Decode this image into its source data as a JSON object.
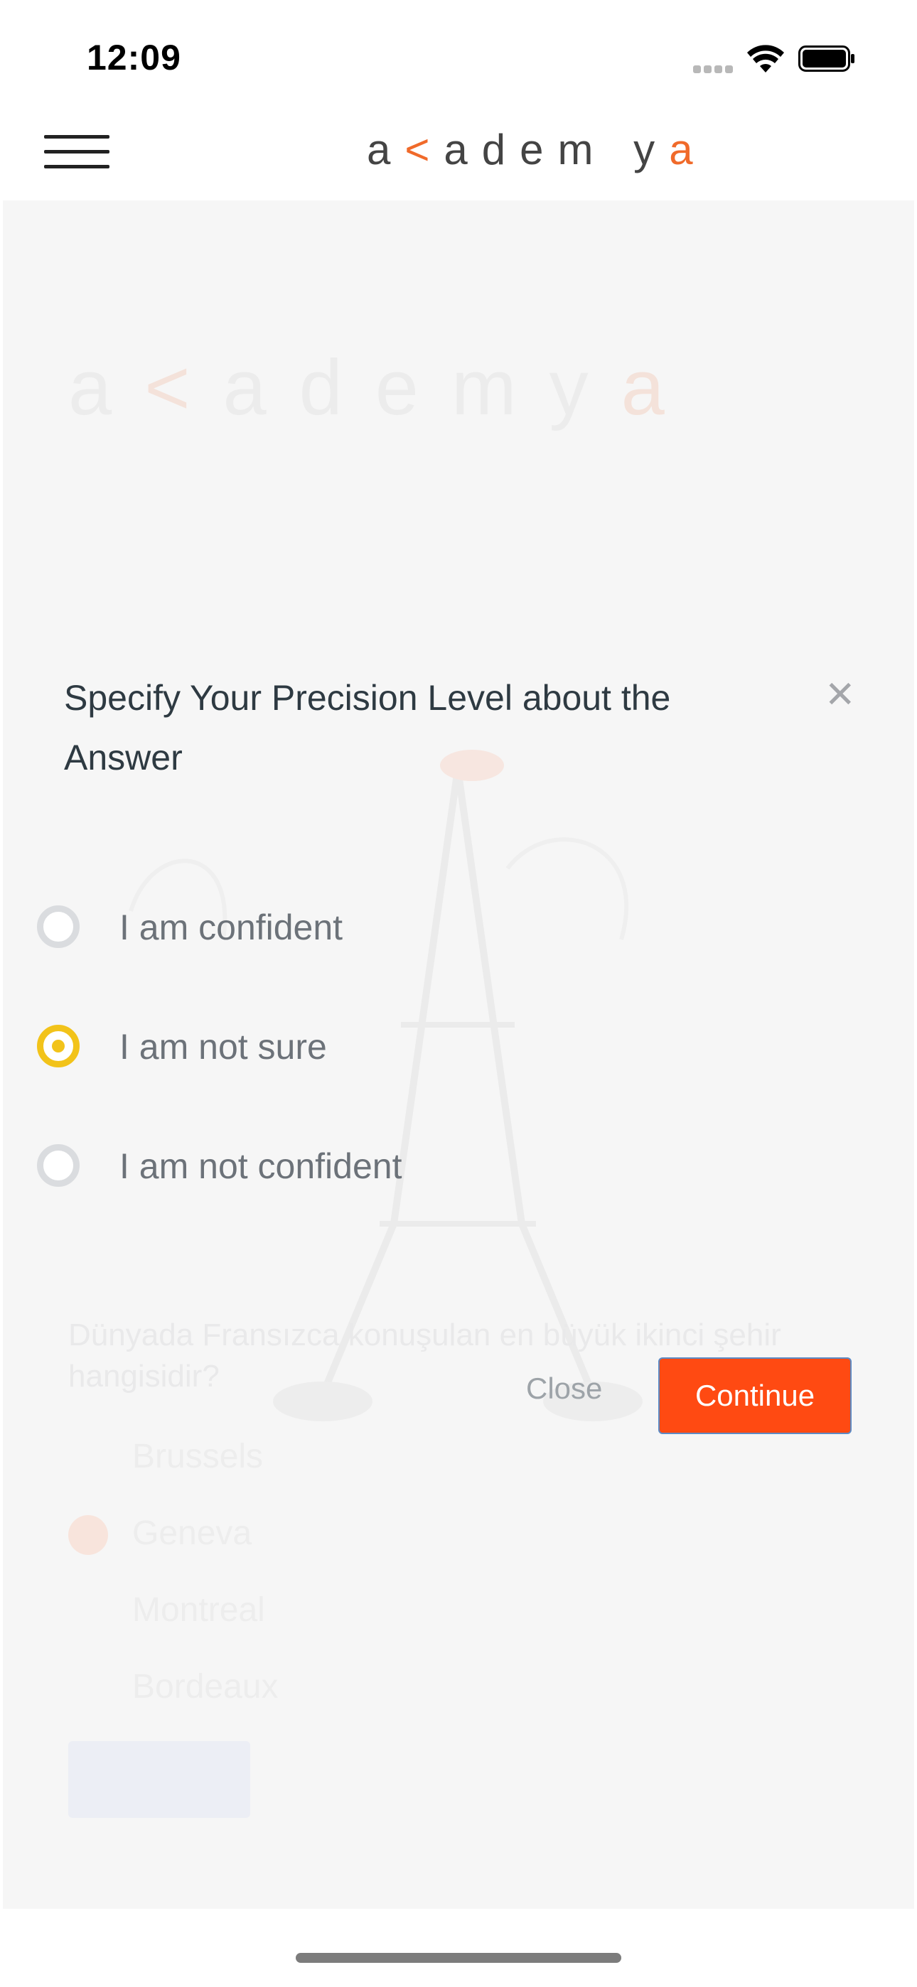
{
  "status_bar": {
    "time": "12:09",
    "icons": [
      "cellular-signal-icon",
      "wifi-icon",
      "battery-icon"
    ]
  },
  "header": {
    "menu_icon": "hamburger-menu-icon",
    "logo": {
      "a1": "a",
      "chevron": "<",
      "middle": "adem y",
      "end": "a"
    },
    "accent_color": "#f06a2a"
  },
  "background": {
    "logo": {
      "a1": "a",
      "chevron": "<",
      "middle": "ademy",
      "end": "a"
    },
    "question": "Dünyada Fransızca konuşulan en büyük ikinci şehir hangisidir?",
    "options": [
      "Brussels",
      "Geneva",
      "Montreal",
      "Bordeaux"
    ],
    "selected_index": 1,
    "button": ""
  },
  "modal": {
    "title": "Specify Your Precision Level about the Answer",
    "close_icon": "close-x-icon",
    "options": [
      {
        "label": "I am confident",
        "selected": false
      },
      {
        "label": "I am not sure",
        "selected": true
      },
      {
        "label": "I am not confident",
        "selected": false
      }
    ],
    "close_label": "Close",
    "continue_label": "Continue",
    "primary_color": "#ff4a12",
    "radio_selected_color": "#f2c31a"
  }
}
